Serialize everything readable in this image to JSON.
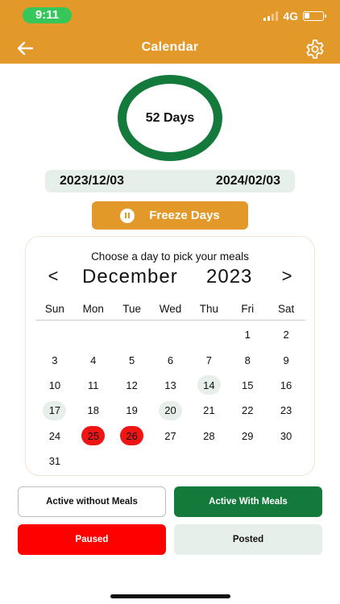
{
  "status_bar": {
    "time": "9:11",
    "network": "4G",
    "battery_level": 0.3
  },
  "header": {
    "title": "Calendar",
    "back_icon": "arrow-left-icon",
    "settings_icon": "gear-icon",
    "background_color": "#e3982a"
  },
  "summary": {
    "days_label": "52 Days",
    "start_date": "2023/12/03",
    "end_date": "2024/02/03",
    "ring_color": "#137a3b"
  },
  "freeze_button": {
    "label": "Freeze Days",
    "icon": "pause-icon"
  },
  "calendar": {
    "prompt": "Choose a day to pick your meals",
    "prev_label": "<",
    "next_label": ">",
    "month": "December",
    "year": "2023",
    "weekdays": [
      "Sun",
      "Mon",
      "Tue",
      "Wed",
      "Thu",
      "Fri",
      "Sat"
    ],
    "days": [
      {
        "label": "",
        "status": "empty"
      },
      {
        "label": "",
        "status": "empty"
      },
      {
        "label": "",
        "status": "empty"
      },
      {
        "label": "",
        "status": "empty"
      },
      {
        "label": "",
        "status": "empty"
      },
      {
        "label": "1",
        "status": "default"
      },
      {
        "label": "2",
        "status": "default"
      },
      {
        "label": "3",
        "status": "default"
      },
      {
        "label": "4",
        "status": "default"
      },
      {
        "label": "5",
        "status": "default"
      },
      {
        "label": "6",
        "status": "default"
      },
      {
        "label": "7",
        "status": "default"
      },
      {
        "label": "8",
        "status": "default"
      },
      {
        "label": "9",
        "status": "default"
      },
      {
        "label": "10",
        "status": "default"
      },
      {
        "label": "11",
        "status": "default"
      },
      {
        "label": "12",
        "status": "default"
      },
      {
        "label": "13",
        "status": "default"
      },
      {
        "label": "14",
        "status": "posted"
      },
      {
        "label": "15",
        "status": "default"
      },
      {
        "label": "16",
        "status": "default"
      },
      {
        "label": "17",
        "status": "posted"
      },
      {
        "label": "18",
        "status": "default"
      },
      {
        "label": "19",
        "status": "default"
      },
      {
        "label": "20",
        "status": "posted"
      },
      {
        "label": "21",
        "status": "default"
      },
      {
        "label": "22",
        "status": "default"
      },
      {
        "label": "23",
        "status": "default"
      },
      {
        "label": "24",
        "status": "default"
      },
      {
        "label": "25",
        "status": "paused"
      },
      {
        "label": "26",
        "status": "paused"
      },
      {
        "label": "27",
        "status": "default"
      },
      {
        "label": "28",
        "status": "default"
      },
      {
        "label": "29",
        "status": "default"
      },
      {
        "label": "30",
        "status": "default"
      },
      {
        "label": "31",
        "status": "default"
      }
    ]
  },
  "legend": {
    "active_without_meals": "Active without Meals",
    "active_with_meals": "Active With Meals",
    "paused": "Paused",
    "posted": "Posted",
    "colors": {
      "active_with_meals": "#137a3b",
      "paused": "#ff0000",
      "posted": "#e7efea"
    }
  }
}
